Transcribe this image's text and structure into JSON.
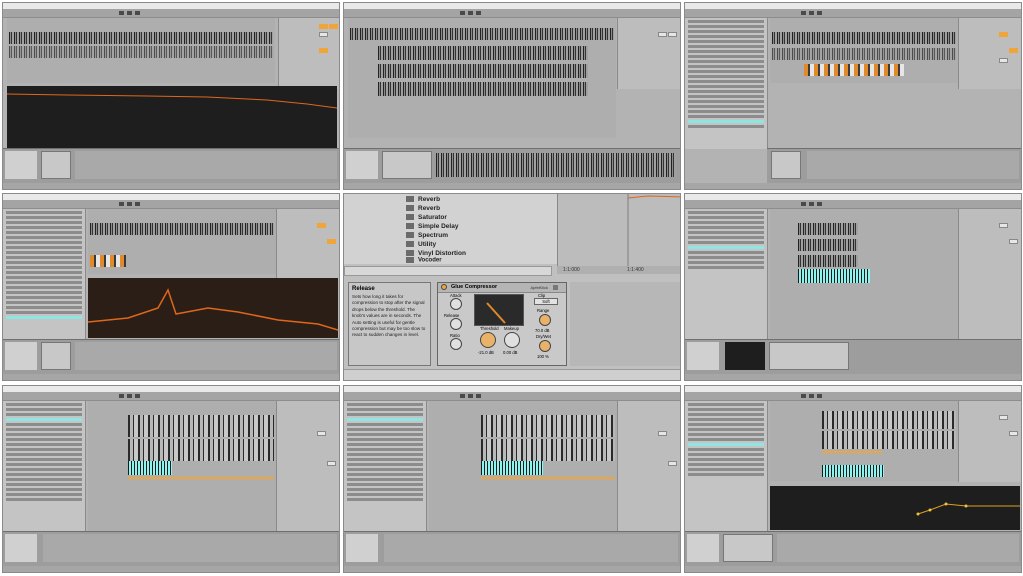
{
  "glue_compressor": {
    "device_title": "Glue Compressor",
    "preset_label": "ApfeiKlick",
    "help_title": "Release",
    "help_text": "Sets how long it takes for compression to stop after the signal drops below the threshold. The knob's values are in seconds. The Auto setting is useful for gentle compression but may be too slow to react to sudden changes in level.",
    "attack_label": "Attack",
    "release_label": "Release",
    "ratio_label": "Ratio",
    "threshold_label": "Threshold",
    "threshold_value": "-21.0 dB",
    "makeup_label": "Makeup",
    "makeup_value": "0.00 dB",
    "clip_label": "Clip",
    "soft_label": "Soft",
    "range_label": "Range",
    "range_value": "70.0 dB",
    "drywet_label": "Dry/Wet",
    "drywet_value": "100 %"
  },
  "browser_items": [
    "Reverb",
    "Saturator",
    "Simple Delay",
    "Spectrum",
    "Utility",
    "Vinyl Distortion",
    "Vocoder"
  ],
  "time_ruler": {
    "left": "1:1:000",
    "right": "1:1:400"
  },
  "colors": {
    "accent": "#f0a53a",
    "selection": "#8ef4ef",
    "analyzer": "#e0661a"
  }
}
